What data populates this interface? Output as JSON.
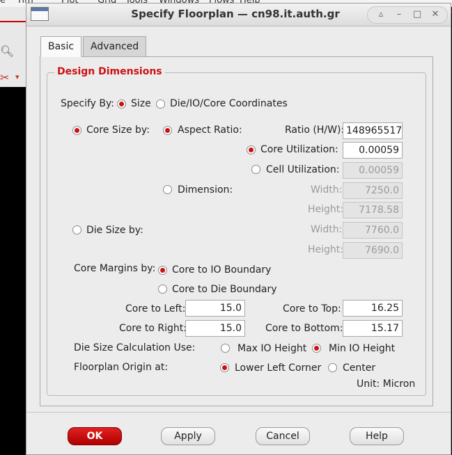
{
  "background": {
    "menu_items": [
      "e",
      "Tim",
      "Plot",
      "Grid",
      "Tools",
      "Windows",
      "Flows",
      "Help"
    ],
    "colors": {
      "accent_red": "#cc1111"
    }
  },
  "window": {
    "title": "Specify Floorplan — cn98.it.auth.gr",
    "buttons": [
      "▵",
      "–",
      "□",
      "✕"
    ]
  },
  "tabs": [
    {
      "label": "Basic",
      "active": true
    },
    {
      "label": "Advanced",
      "active": false
    }
  ],
  "group_title": "Design Dimensions",
  "specify_by": {
    "label": "Specify By:",
    "options": [
      {
        "label": "Size",
        "selected": true
      },
      {
        "label": "Die/IO/Core Coordinates",
        "selected": false
      }
    ]
  },
  "core_size": {
    "label": "Core Size by:",
    "selected": true,
    "aspect_ratio": {
      "label": "Aspect Ratio:",
      "selected": true,
      "ratio_label": "Ratio (H/W):",
      "ratio_value": "148965517",
      "core_util_label": "Core Utilization:",
      "core_util_selected": true,
      "core_util_value": "0.00059",
      "cell_util_label": "Cell Utilization:",
      "cell_util_selected": false,
      "cell_util_value": "0.00059"
    },
    "dimension": {
      "label": "Dimension:",
      "selected": false,
      "width_label": "Width:",
      "width_value": "7250.0",
      "height_label": "Height:",
      "height_value": "7178.58"
    }
  },
  "die_size": {
    "label": "Die Size by:",
    "selected": false,
    "width_label": "Width:",
    "width_value": "7760.0",
    "height_label": "Height:",
    "height_value": "7690.0"
  },
  "core_margins": {
    "label": "Core Margins by:",
    "options": [
      {
        "label": "Core to IO Boundary",
        "selected": true
      },
      {
        "label": "Core to Die Boundary",
        "selected": false
      }
    ],
    "left_label": "Core to Left:",
    "left_value": "15.0",
    "top_label": "Core to Top:",
    "top_value": "16.25",
    "right_label": "Core to Right:",
    "right_value": "15.0",
    "bottom_label": "Core to Bottom:",
    "bottom_value": "15.17"
  },
  "die_calc": {
    "label": "Die Size Calculation Use:",
    "options": [
      {
        "label": "Max IO Height",
        "selected": false
      },
      {
        "label": "Min IO Height",
        "selected": true
      }
    ]
  },
  "origin": {
    "label": "Floorplan Origin at:",
    "options": [
      {
        "label": "Lower Left Corner",
        "selected": true
      },
      {
        "label": "Center",
        "selected": false
      }
    ]
  },
  "unit": "Unit: Micron",
  "buttons": {
    "ok": "OK",
    "apply": "Apply",
    "cancel": "Cancel",
    "help": "Help"
  }
}
